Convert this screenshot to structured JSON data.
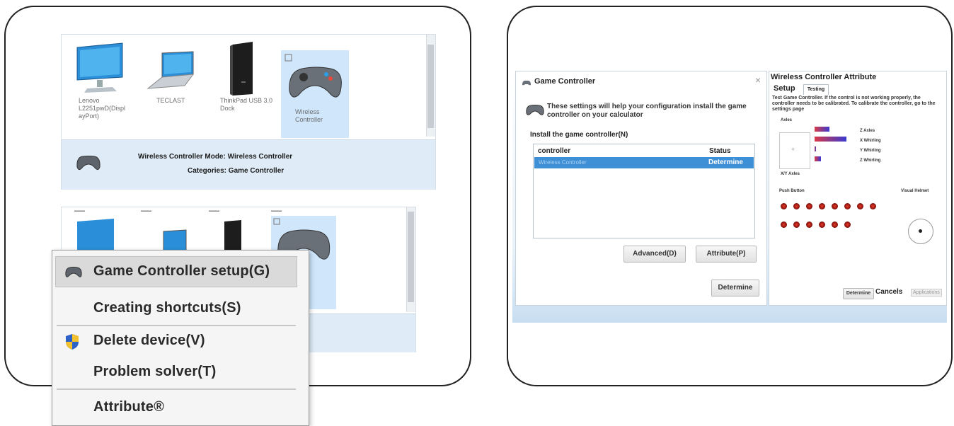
{
  "left_panel": {
    "devices_top": [
      {
        "label": "Lenovo L2251pwD(Displ ayPort)",
        "icon": "monitor-icon",
        "selected": false
      },
      {
        "label": "TECLAST",
        "icon": "laptop-icon",
        "selected": false
      },
      {
        "label": "ThinkPad USB 3.0 Dock",
        "icon": "dock-icon",
        "selected": false
      },
      {
        "label": "Wireless Controller",
        "icon": "gamepad-icon",
        "selected": true
      }
    ],
    "detail": {
      "line1": "Wireless Controller Mode: Wireless Controller",
      "line2": "Categories: Game Controller"
    },
    "context_menu": {
      "items": [
        {
          "label": "Game Controller setup(G)",
          "icon": "gamepad-icon",
          "highlighted": true
        },
        {
          "label": "Creating shortcuts(S)",
          "icon": "",
          "highlighted": false
        },
        {
          "label": "Delete device(V)",
          "icon": "shield-icon",
          "highlighted": false
        },
        {
          "label": "Problem solver(T)",
          "icon": "",
          "highlighted": false
        },
        {
          "label": "Attribute®",
          "icon": "",
          "highlighted": false
        }
      ]
    }
  },
  "right_panel": {
    "game_controller": {
      "title": "Game Controller",
      "close": "×",
      "intro": "These settings will help your configuration install the game controller on your calculator",
      "install_label": "Install the game controller(N)",
      "columns": [
        "controller",
        "Status"
      ],
      "rows": [
        {
          "controller": "Wireless Controller",
          "status": "Determine",
          "selected": true
        }
      ],
      "advanced_button": "Advanced(D)",
      "attribute_button": "Attribute(P)",
      "determine_button": "Determine"
    },
    "attribute_window": {
      "title": "Wireless Controller Attribute",
      "tabs": [
        "Setup",
        "Testing"
      ],
      "description": "Test Game Controller. If the control is not working properly, the controller needs to be calibrated. To calibrate the controller, go to the settings page",
      "axes_label": "Axles",
      "xy_label": "X/Y Axles",
      "axis_names": [
        "Z Axles",
        "X Whirling",
        "Y Whirling",
        "Z Whirling"
      ],
      "axis_levels": [
        0.35,
        0.75,
        0.0,
        0.15
      ],
      "push_button_label": "Push Button",
      "visual_helmet_label": "Visual Helmet",
      "push_button_count": 14,
      "buttons": {
        "determine": "Determine",
        "cancels": "Cancels",
        "applications": "Applications"
      }
    }
  },
  "colors": {
    "selection_blue": "#3d8fd6",
    "selected_tile": "#cfe6fb",
    "detail_bar": "#dfecf7",
    "menu_bg": "#f5f5f5",
    "axis_bar_gradient_start": "#d83a48",
    "axis_bar_gradient_end": "#3a3ad0"
  }
}
